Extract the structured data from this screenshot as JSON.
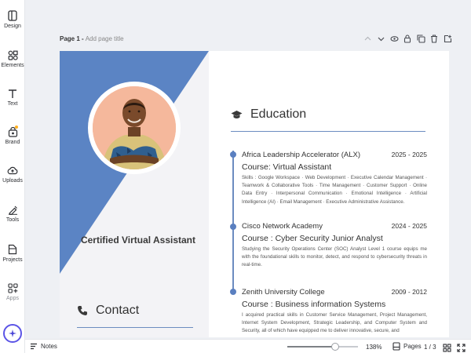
{
  "rail": {
    "design": "Design",
    "elements": "Elements",
    "text": "Text",
    "brand": "Brand",
    "uploads": "Uploads",
    "tools": "Tools",
    "projects": "Projects",
    "apps": "Apps"
  },
  "page_header": {
    "page_label": "Page 1 -",
    "title_placeholder": "Add page title"
  },
  "resume": {
    "headline": "Certified Virtual Assistant",
    "contact_heading": "Contact",
    "education_heading": "Education",
    "education": [
      {
        "institution": "Africa Leadership Accelerator (ALX)",
        "years": "2025 - 2025",
        "course": "Course: Virtual Assistant",
        "description": "Skills : Google Workspace · Web Development · Executive Calendar Management · Teamwork & Collaborative Tools · Time Management · Customer Support · Online Data Entry · Interpersonal Communication · Emotional Intelligence · Artificial Intelligence (AI) · Email Management · Executive Administrative Assistance."
      },
      {
        "institution": "Cisco Network Academy",
        "years": "2024 - 2025",
        "course": "Course : Cyber Security Junior Analyst",
        "description": "Studying the Security Operations Center (SOC) Analyst Level 1 course equips me with the foundational skills to monitor, detect, and respond to cybersecurity threats in real-time."
      },
      {
        "institution": "Zenith University College",
        "years": "2009 - 2012",
        "course": "Course : Business information Systems",
        "description": "I acquired practical skills in Customer Service Management, Project Management, Internet System Development, Strategic Leadership, and Computer System and Security, all of which have equipped me to deliver innovative, secure, and"
      }
    ]
  },
  "bottom_bar": {
    "notes": "Notes",
    "zoom_level": "138%",
    "zoom_fraction": 0.68,
    "pages_label": "Pages",
    "page_count": "1 / 3"
  },
  "colors": {
    "accent_blue": "#5b84c4",
    "timeline_blue": "#6c8cc0",
    "photo_bg": "#f5b89c",
    "brand_dot": "#ffb020",
    "magic_ring": "#5b54e6"
  },
  "icons": {
    "design": "layout-icon",
    "elements": "shapes-icon",
    "text": "text-t-icon",
    "brand": "crown-bag-icon",
    "uploads": "cloud-upload-icon",
    "tools": "pen-tool-icon",
    "projects": "folder-icon",
    "apps": "apps-grid-plus-icon",
    "magic": "sparkle-icon",
    "education": "graduation-cap-icon",
    "contact": "phone-icon"
  }
}
